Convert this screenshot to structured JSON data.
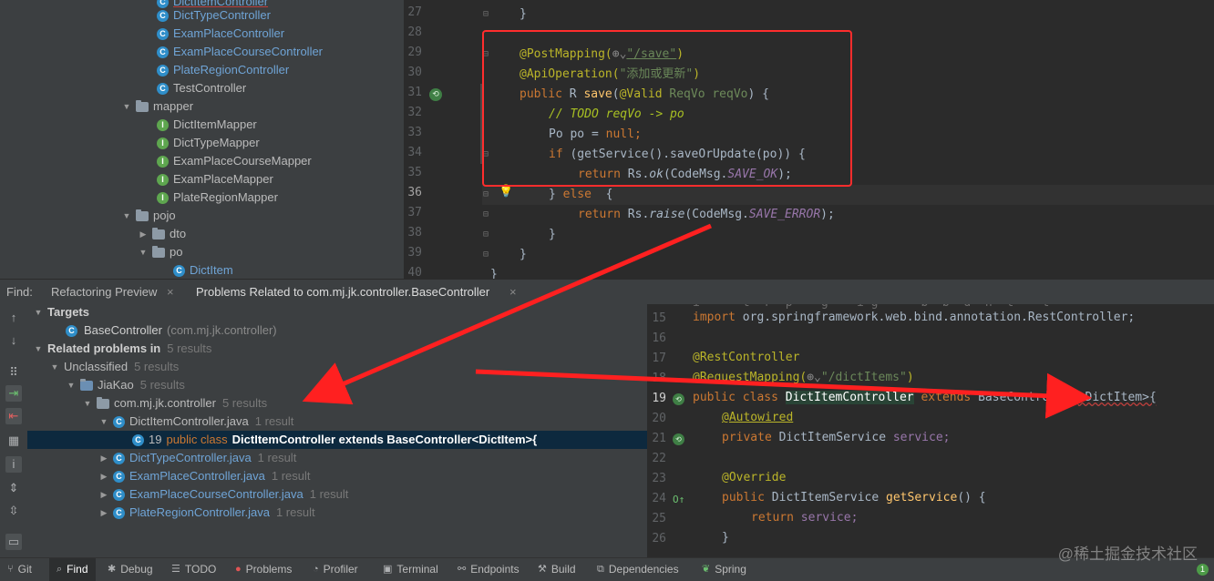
{
  "project_tree": {
    "items": [
      {
        "label": "DictItemController",
        "icon": "class-icon"
      },
      {
        "label": "DictTypeController",
        "icon": "class-icon"
      },
      {
        "label": "ExamPlaceController",
        "icon": "class-icon"
      },
      {
        "label": "ExamPlaceCourseController",
        "icon": "class-icon"
      },
      {
        "label": "PlateRegionController",
        "icon": "class-icon"
      },
      {
        "label": "TestController",
        "icon": "class-icon"
      },
      {
        "label": "mapper",
        "icon": "folder-icon"
      },
      {
        "label": "DictItemMapper",
        "icon": "interface-icon"
      },
      {
        "label": "DictTypeMapper",
        "icon": "interface-icon"
      },
      {
        "label": "ExamPlaceCourseMapper",
        "icon": "interface-icon"
      },
      {
        "label": "ExamPlaceMapper",
        "icon": "interface-icon"
      },
      {
        "label": "PlateRegionMapper",
        "icon": "interface-icon"
      },
      {
        "label": "pojo",
        "icon": "folder-icon"
      },
      {
        "label": "dto",
        "icon": "folder-icon"
      },
      {
        "label": "po",
        "icon": "folder-icon"
      },
      {
        "label": "DictItem",
        "icon": "class-icon"
      }
    ]
  },
  "top_editor": {
    "line_numbers": [
      "27",
      "28",
      "29",
      "30",
      "31",
      "32",
      "33",
      "34",
      "35",
      "36",
      "37",
      "38",
      "39",
      "40"
    ],
    "code": {
      "l27": "}",
      "l29_ann": "@PostMapping(",
      "l29_str": "\"/save\"",
      "l29_end": ")",
      "l30_ann": "@ApiOperation(",
      "l30_str": "\"添加或更新\"",
      "l30_end": ")",
      "l31_kw": "public",
      "l31_type": "R",
      "l31_fn": "save",
      "l31_ann": "@Valid",
      "l31_ptype": "ReqVo",
      "l31_pname": "reqVo",
      "l31_end": ") {",
      "l32": "// TODO reqVo -> po",
      "l33_type": "Po po =",
      "l33_kw": "null",
      "l34_kw": "if",
      "l34_rest": "(getService().saveOrUpdate(po)) {",
      "l35_kw": "return",
      "l35_rs": "Rs.",
      "l35_fn": "ok",
      "l35_arg": "(CodeMsg.",
      "l35_cst": "SAVE_OK",
      "l35_end": ");",
      "l36_a": "}",
      "l36_kw": "else",
      "l36_b": "{",
      "l37_kw": "return",
      "l37_rs": "Rs.",
      "l37_fn": "raise",
      "l37_arg": "(CodeMsg.",
      "l37_cst": "SAVE_ERROR",
      "l37_end": ");",
      "l38": "}",
      "l39": "}",
      "l40": "}"
    }
  },
  "find_bar": {
    "find_label": "Find:",
    "tab_refactoring": "Refactoring Preview",
    "tab_problems": "Problems Related to com.mj.jk.controller.BaseController",
    "close": "×"
  },
  "problems": {
    "targets": "Targets",
    "base_controller": "BaseController",
    "base_controller_pkg": "(com.mj.jk.controller)",
    "related": "Related problems in",
    "related_count": "5 results",
    "unclassified": "Unclassified",
    "unclassified_count": "5 results",
    "module": "JiaKao",
    "module_count": "5 results",
    "package": "com.mj.jk.controller",
    "package_count": "5 results",
    "files": [
      {
        "name": "DictItemController.java",
        "count": "1 result"
      },
      {
        "name": "DictTypeController.java",
        "count": "1 result"
      },
      {
        "name": "ExamPlaceController.java",
        "count": "1 result"
      },
      {
        "name": "ExamPlaceCourseController.java",
        "count": "1 result"
      },
      {
        "name": "PlateRegionController.java",
        "count": "1 result"
      }
    ],
    "usage_line": "19",
    "usage_pre": "public class",
    "usage_bold": "DictItemController extends BaseController<DictItem>{"
  },
  "bottom_editor": {
    "line_numbers": [
      "15",
      "16",
      "17",
      "18",
      "19",
      "20",
      "21",
      "22",
      "23",
      "24",
      "25",
      "26"
    ],
    "code": {
      "l15_kw": "import",
      "l15_rest": "org.springframework.web.bind.annotation.RestController;",
      "l17": "@RestController",
      "l18_ann": "@RequestMapping(",
      "l18_str": "\"/dictItems\"",
      "l18_end": ")",
      "l19_kw": "public class",
      "l19_cls": "DictItemController",
      "l19_ext": "extends",
      "l19_base": "BaseController",
      "l19_gen": "<DictItem>{",
      "l20": "@Autowired",
      "l21_kw": "private",
      "l21_type": "DictItemService",
      "l21_fld": "service;",
      "l23": "@Override",
      "l24_kw": "public",
      "l24_type": "DictItemService",
      "l24_fn": "getService",
      "l24_end": "() {",
      "l25_kw": "return",
      "l25_fld": "service;",
      "l26": "}"
    }
  },
  "status_bar": {
    "items": [
      "Git",
      "Find",
      "Debug",
      "TODO",
      "Problems",
      "Profiler",
      "Terminal",
      "Endpoints",
      "Build",
      "Dependencies",
      "Spring"
    ],
    "notification_count": "1"
  },
  "watermark": "@稀土掘金技术社区",
  "colors": {
    "annotation_box": "#ff2d2d",
    "arrow": "#ff2020",
    "selection": "#0d293e"
  }
}
